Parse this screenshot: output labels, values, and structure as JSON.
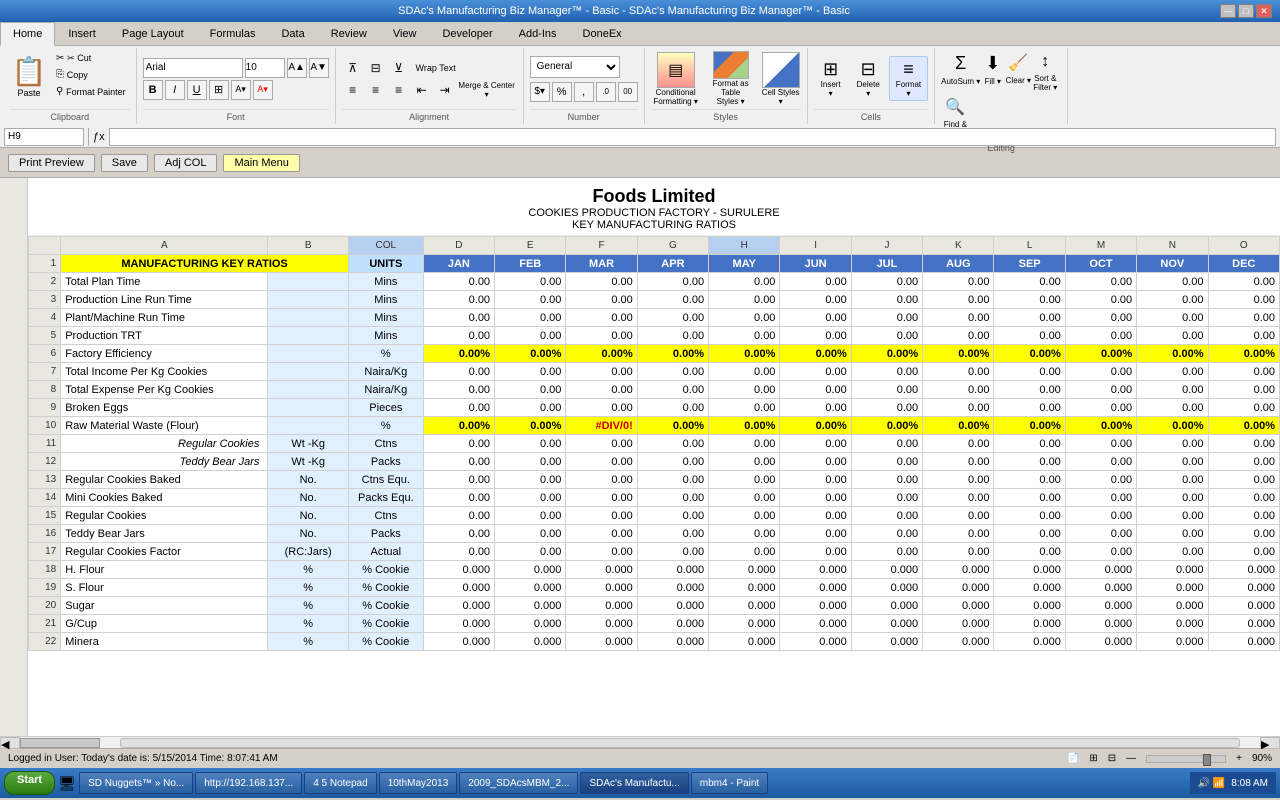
{
  "titleBar": {
    "title": "SDAc's Manufacturing Biz Manager™ - Basic - SDAc's Manufacturing Biz Manager™ - Basic",
    "controls": [
      "—",
      "□",
      "✕"
    ]
  },
  "ribbonTabs": [
    "Home",
    "Insert",
    "Page Layout",
    "Formulas",
    "Data",
    "Review",
    "View",
    "Developer",
    "Add-Ins",
    "DoneEx"
  ],
  "activeTab": "Home",
  "clipboard": {
    "paste": "Paste",
    "cut": "✂ Cut",
    "copy": "⎘ Copy",
    "formatPainter": "⚲ Format Painter",
    "label": "Clipboard"
  },
  "font": {
    "name": "Arial",
    "size": "10",
    "bold": "B",
    "italic": "I",
    "underline": "U",
    "label": "Font"
  },
  "alignment": {
    "label": "Alignment",
    "wrapText": "Wrap Text",
    "mergeCenterLabel": "Merge & Center"
  },
  "number": {
    "format": "$  %  ,  .0  00",
    "label": "Number"
  },
  "styles": {
    "conditional": "Conditional\nFormatting",
    "formatAsTable": "Format as Table",
    "cellStyles": "Cell\nStyles",
    "label": "Styles"
  },
  "cells": {
    "insert": "Insert",
    "delete": "Delete",
    "format": "Format",
    "label": "Cells"
  },
  "editing": {
    "autosum": "AutoSum",
    "fill": "Fill",
    "clear": "Clear",
    "sortFilter": "Sort &\nFilter",
    "findSelect": "Find &\nSelect",
    "label": "Editing"
  },
  "formulaBar": {
    "nameBox": "H9",
    "formula": ""
  },
  "toolbar": {
    "printPreview": "Print Preview",
    "save": "Save",
    "adjCol": "Adj COL",
    "mainMenu": "Main Menu"
  },
  "report": {
    "title": "Foods Limited",
    "subtitle": "COOKIES PRODUCTION FACTORY - SURULERE",
    "subtitle2": "KEY MANUFACTURING RATIOS"
  },
  "colHeaders": [
    "",
    "",
    "UNITS",
    "JAN",
    "FEB",
    "MAR",
    "APR",
    "MAY",
    "JUN",
    "JUL",
    "AUG",
    "SEP",
    "OCT",
    "NOV",
    "DEC"
  ],
  "tableHeader": "MANUFACTURING KEY RATIOS",
  "rows": [
    {
      "label": "Total Plan Time",
      "sub": "",
      "units": "Mins",
      "values": [
        "0.00",
        "0.00",
        "0.00",
        "0.00",
        "0.00",
        "0.00",
        "0.00",
        "0.00",
        "0.00",
        "0.00",
        "0.00",
        "0.00"
      ],
      "style": ""
    },
    {
      "label": "Production Line Run Time",
      "sub": "",
      "units": "Mins",
      "values": [
        "0.00",
        "0.00",
        "0.00",
        "0.00",
        "0.00",
        "0.00",
        "0.00",
        "0.00",
        "0.00",
        "0.00",
        "0.00",
        "0.00"
      ],
      "style": ""
    },
    {
      "label": "Plant/Machine Run Time",
      "sub": "",
      "units": "Mins",
      "values": [
        "0.00",
        "0.00",
        "0.00",
        "0.00",
        "0.00",
        "0.00",
        "0.00",
        "0.00",
        "0.00",
        "0.00",
        "0.00",
        "0.00"
      ],
      "style": ""
    },
    {
      "label": "Production TRT",
      "sub": "",
      "units": "Mins",
      "values": [
        "0.00",
        "0.00",
        "0.00",
        "0.00",
        "0.00",
        "0.00",
        "0.00",
        "0.00",
        "0.00",
        "0.00",
        "0.00",
        "0.00"
      ],
      "style": ""
    },
    {
      "label": "Factory Efficiency",
      "sub": "",
      "units": "%",
      "values": [
        "0.00%",
        "0.00%",
        "0.00%",
        "0.00%",
        "0.00%",
        "0.00%",
        "0.00%",
        "0.00%",
        "0.00%",
        "0.00%",
        "0.00%",
        "0.00%"
      ],
      "style": "yellow"
    },
    {
      "label": "Total Income Per Kg Cookies",
      "sub": "",
      "units": "Naira/Kg",
      "values": [
        "0.00",
        "0.00",
        "0.00",
        "0.00",
        "0.00",
        "0.00",
        "0.00",
        "0.00",
        "0.00",
        "0.00",
        "0.00",
        "0.00"
      ],
      "style": ""
    },
    {
      "label": "Total Expense Per Kg Cookies",
      "sub": "",
      "units": "Naira/Kg",
      "values": [
        "0.00",
        "0.00",
        "0.00",
        "0.00",
        "0.00",
        "0.00",
        "0.00",
        "0.00",
        "0.00",
        "0.00",
        "0.00",
        "0.00"
      ],
      "style": ""
    },
    {
      "label": "Broken Eggs",
      "sub": "",
      "units": "Pieces",
      "values": [
        "0.00",
        "0.00",
        "0.00",
        "0.00",
        "0.00",
        "0.00",
        "0.00",
        "0.00",
        "0.00",
        "0.00",
        "0.00",
        "0.00"
      ],
      "style": ""
    },
    {
      "label": "Raw Material Waste (Flour)",
      "sub": "",
      "units": "%",
      "values": [
        "0.00%",
        "0.00%",
        "#DIV/0!",
        "0.00%",
        "0.00%",
        "0.00%",
        "0.00%",
        "0.00%",
        "0.00%",
        "0.00%",
        "0.00%",
        "0.00%"
      ],
      "style": "yellow",
      "errorCol": 2
    },
    {
      "label": "",
      "sub": "Regular Cookies",
      "units": "Ctns",
      "subunits": "Wt -Kg",
      "values": [
        "0.00",
        "0.00",
        "0.00",
        "0.00",
        "0.00",
        "0.00",
        "0.00",
        "0.00",
        "0.00",
        "0.00",
        "0.00",
        "0.00"
      ],
      "style": "sub"
    },
    {
      "label": "",
      "sub": "Teddy Bear Jars",
      "units": "Packs",
      "subunits": "Wt -Kg",
      "values": [
        "0.00",
        "0.00",
        "0.00",
        "0.00",
        "0.00",
        "0.00",
        "0.00",
        "0.00",
        "0.00",
        "0.00",
        "0.00",
        "0.00"
      ],
      "style": "sub"
    },
    {
      "label": "Regular Cookies Baked",
      "sub": "",
      "units": "Ctns Equ.",
      "subunits": "No.",
      "values": [
        "0.00",
        "0.00",
        "0.00",
        "0.00",
        "0.00",
        "0.00",
        "0.00",
        "0.00",
        "0.00",
        "0.00",
        "0.00",
        "0.00"
      ],
      "style": ""
    },
    {
      "label": "Mini Cookies Baked",
      "sub": "",
      "units": "Packs Equ.",
      "subunits": "No.",
      "values": [
        "0.00",
        "0.00",
        "0.00",
        "0.00",
        "0.00",
        "0.00",
        "0.00",
        "0.00",
        "0.00",
        "0.00",
        "0.00",
        "0.00"
      ],
      "style": ""
    },
    {
      "label": "Regular Cookies",
      "sub": "",
      "units": "Ctns",
      "subunits": "No.",
      "values": [
        "0.00",
        "0.00",
        "0.00",
        "0.00",
        "0.00",
        "0.00",
        "0.00",
        "0.00",
        "0.00",
        "0.00",
        "0.00",
        "0.00"
      ],
      "style": ""
    },
    {
      "label": "Teddy Bear Jars",
      "sub": "",
      "units": "Packs",
      "subunits": "No.",
      "values": [
        "0.00",
        "0.00",
        "0.00",
        "0.00",
        "0.00",
        "0.00",
        "0.00",
        "0.00",
        "0.00",
        "0.00",
        "0.00",
        "0.00"
      ],
      "style": ""
    },
    {
      "label": "Regular Cookies Factor",
      "sub": "",
      "units": "Actual",
      "subunits": "(RC:Jars)",
      "values": [
        "0.00",
        "0.00",
        "0.00",
        "0.00",
        "0.00",
        "0.00",
        "0.00",
        "0.00",
        "0.00",
        "0.00",
        "0.00",
        "0.00"
      ],
      "style": ""
    },
    {
      "label": "H. Flour",
      "sub": "",
      "units": "% Cookie",
      "subunits": "%",
      "values": [
        "0.000",
        "0.000",
        "0.000",
        "0.000",
        "0.000",
        "0.000",
        "0.000",
        "0.000",
        "0.000",
        "0.000",
        "0.000",
        "0.000"
      ],
      "style": ""
    },
    {
      "label": "S. Flour",
      "sub": "",
      "units": "% Cookie",
      "subunits": "%",
      "values": [
        "0.000",
        "0.000",
        "0.000",
        "0.000",
        "0.000",
        "0.000",
        "0.000",
        "0.000",
        "0.000",
        "0.000",
        "0.000",
        "0.000"
      ],
      "style": ""
    },
    {
      "label": "Sugar",
      "sub": "",
      "units": "% Cookie",
      "subunits": "%",
      "values": [
        "0.000",
        "0.000",
        "0.000",
        "0.000",
        "0.000",
        "0.000",
        "0.000",
        "0.000",
        "0.000",
        "0.000",
        "0.000",
        "0.000"
      ],
      "style": ""
    },
    {
      "label": "G/Cup",
      "sub": "",
      "units": "% Cookie",
      "subunits": "%",
      "values": [
        "0.000",
        "0.000",
        "0.000",
        "0.000",
        "0.000",
        "0.000",
        "0.000",
        "0.000",
        "0.000",
        "0.000",
        "0.000",
        "0.000"
      ],
      "style": ""
    },
    {
      "label": "Minera",
      "sub": "",
      "units": "% Cookie",
      "subunits": "%",
      "values": [
        "0.000",
        "0.000",
        "0.000",
        "0.000",
        "0.000",
        "0.000",
        "0.000",
        "0.000",
        "0.000",
        "0.000",
        "0.000",
        "0.000"
      ],
      "style": ""
    }
  ],
  "statusBar": {
    "left": "Logged in User:  Today's date is: 5/15/2014  Time: 8:07:41 AM",
    "zoom": "90%"
  },
  "taskbarItems": [
    {
      "label": "Start",
      "type": "start"
    },
    {
      "label": "SD Nuggets™ » No..."
    },
    {
      "label": "http://192.168.137..."
    },
    {
      "label": "4 5 Notepad"
    },
    {
      "label": "10thMay2013"
    },
    {
      "label": "2009_SDAcsMBM_2..."
    },
    {
      "label": "SDAc's Manufactu...",
      "active": true
    },
    {
      "label": "mbm4 - Paint"
    }
  ],
  "taskbarClock": "8:08 AM"
}
